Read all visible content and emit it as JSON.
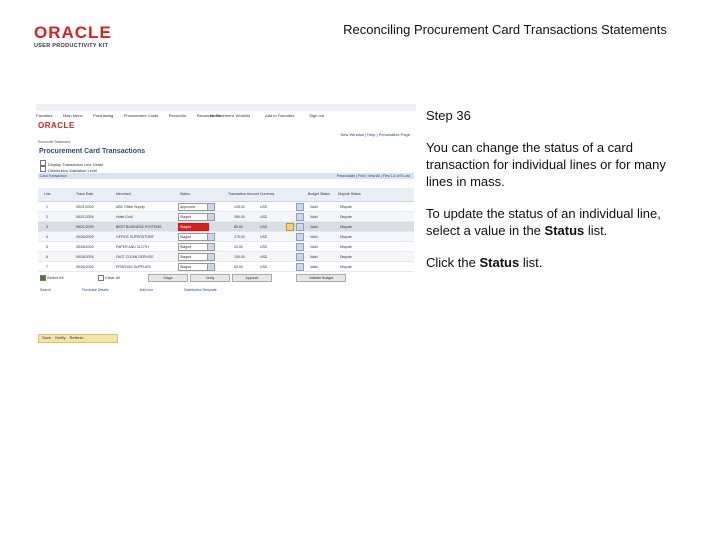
{
  "logo": {
    "main": "ORACLE",
    "sub": "USER PRODUCTIVITY KIT"
  },
  "header": {
    "title": "Reconciling Procurement Card Transactions Statements"
  },
  "screenshot": {
    "topbar": [
      "Favorites",
      "Main Menu",
      "Purchasing",
      "Procurement Cards",
      "Reconcile",
      "Reconcile Statement"
    ],
    "brand": "ORACLE",
    "menubar": [
      "Home",
      "Worklist",
      "Add to Favorites",
      "Sign out"
    ],
    "links": "New Window | Help | Personalize Page",
    "breadcrumb": "Reconcile Statement",
    "page_title": "Procurement Card Transactions",
    "options": [
      "Display Transaction Line Detail",
      "Distribution Validation Level"
    ],
    "grid_header": {
      "title": "Card Transaction",
      "nav": "Personalize | Find | View All | First 1-6 of 6 Last"
    },
    "tabs": [
      "Transaction",
      "Billing",
      "Tax"
    ],
    "columns": [
      "Line",
      "Trans Date",
      "Merchant",
      "Status",
      "Transaction Amount",
      "Currency",
      "Budget Status",
      "Dispute Status"
    ],
    "rows": [
      {
        "line": "1",
        "date": "05/21/2009",
        "merchant": "ABC Office Supply",
        "status": "Approved",
        "amount": "125.00",
        "currency": "USD",
        "budget": "Valid",
        "dispute": "Dispute"
      },
      {
        "line": "2",
        "date": "05/21/2009",
        "merchant": "Hotel Gold",
        "status": "Staged",
        "amount": "350.00",
        "currency": "USD",
        "budget": "Valid",
        "dispute": "Dispute"
      },
      {
        "line": "3",
        "date": "05/21/2009",
        "merchant": "BEST BUSINESS SYSTEMS",
        "status": "Staged",
        "amount": "85.00",
        "currency": "USD",
        "budget": "Valid",
        "dispute": "Dispute"
      },
      {
        "line": "4",
        "date": "05/26/2009",
        "merchant": "OFFICE SUPERSTORE",
        "status": "Staged",
        "amount": "275.00",
        "currency": "USD",
        "budget": "Valid",
        "dispute": "Dispute"
      },
      {
        "line": "5",
        "date": "05/26/2009",
        "merchant": "PAPER AND CLOTH",
        "status": "Staged",
        "amount": "40.00",
        "currency": "USD",
        "budget": "Valid",
        "dispute": "Dispute"
      },
      {
        "line": "6",
        "date": "05/26/2009",
        "merchant": "FAST CLEAN SERVICE",
        "status": "Staged",
        "amount": "150.00",
        "currency": "USD",
        "budget": "Valid",
        "dispute": "Dispute"
      },
      {
        "line": "7",
        "date": "05/26/2009",
        "merchant": "PRINTING SUPPLIES",
        "status": "Staged",
        "amount": "60.00",
        "currency": "USD",
        "budget": "Valid",
        "dispute": "Dispute"
      }
    ],
    "bottom": {
      "select_all": "Select All",
      "clear_all": "Clear All",
      "buttons": [
        "Stage",
        "Verify",
        "Approve",
        "Validate Budget"
      ]
    },
    "footer_links": [
      "Search",
      "Purchase Details",
      "Add Line",
      "Distribution Template"
    ],
    "savebar": [
      "Save",
      "Notify",
      "Refresh"
    ]
  },
  "instructions": {
    "step": "Step 36",
    "p1": "You can change the status of a card transaction for individual lines or for many lines in mass.",
    "p2_pre": "To update the status of an individual line, select a value in the ",
    "p2_bold": "Status",
    "p2_post": " list.",
    "p3_pre": "Click the ",
    "p3_bold": "Status",
    "p3_post": " list."
  },
  "colors": {
    "brand_red": "#d9201f",
    "highlight": "#e01010",
    "link": "#224488"
  }
}
